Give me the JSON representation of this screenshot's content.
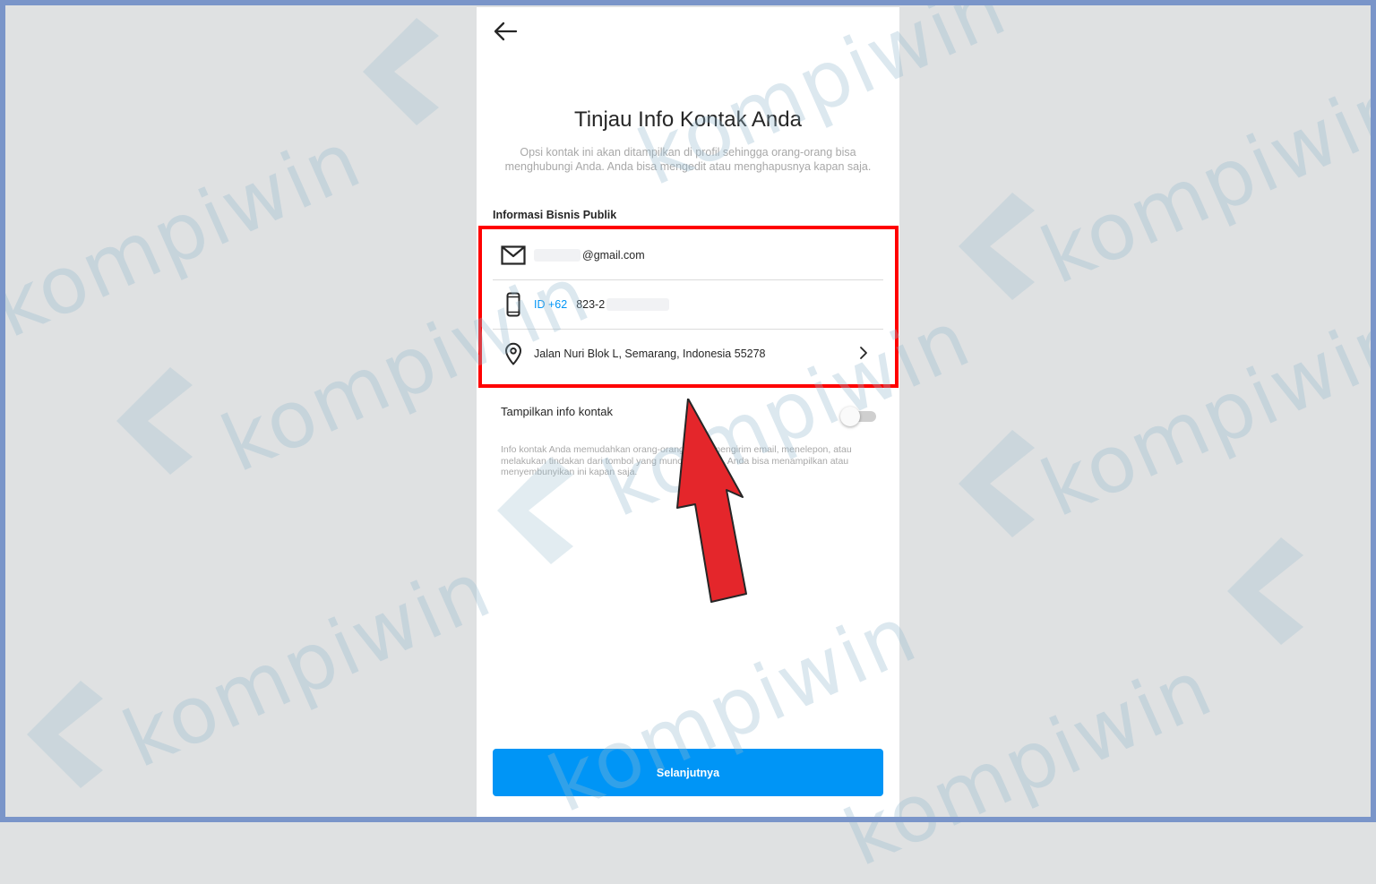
{
  "screen": {
    "title": "Tinjau Info Kontak Anda",
    "subtitle": "Opsi kontak ini akan ditampilkan di profil sehingga orang-orang bisa menghubungi Anda. Anda bisa mengedit atau menghapusnya kapan saja.",
    "section_label": "Informasi Bisnis Publik",
    "email": {
      "value": "@gmail.com",
      "icon": "mail-icon"
    },
    "phone": {
      "country_code": "ID +62",
      "value": "823-2",
      "icon": "phone-icon"
    },
    "address": {
      "value": "Jalan Nuri Blok L, Semarang, Indonesia 55278",
      "icon": "location-pin-icon"
    },
    "toggle": {
      "label": "Tampilkan info kontak",
      "checked": false
    },
    "help_text": "Info kontak Anda memudahkan orang-orang untuk mengirim email, menelepon, atau melakukan tindakan dari tombol yang muncul di profil. Anda bisa menampilkan atau menyembunyikan ini kapan saja.",
    "next_button": "Selanjutnya"
  },
  "annotation": {
    "highlight_color": "#ff0000",
    "arrow_color": "#e4262b"
  },
  "watermark": {
    "text": "kompiwin"
  },
  "colors": {
    "accent": "#0095f6",
    "background": "#dfe1e2",
    "frame": "#7a95c9"
  }
}
